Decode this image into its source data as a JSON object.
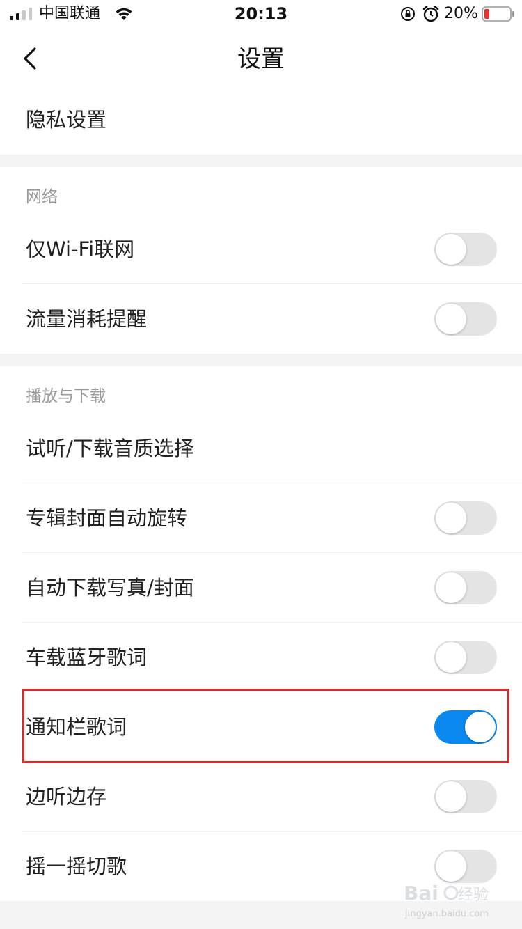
{
  "status_bar": {
    "carrier": "中国联通",
    "time": "20:13",
    "battery_percent": "20%",
    "battery_level": 0.2,
    "battery_color": "#e8312f"
  },
  "nav": {
    "title": "设置",
    "back_icon": "chevron-left-icon"
  },
  "top_rows": [
    {
      "label": "隐私设置"
    }
  ],
  "sections": [
    {
      "header": "网络",
      "rows": [
        {
          "label": "仅Wi-Fi联网",
          "toggle": false
        },
        {
          "label": "流量消耗提醒",
          "toggle": false
        }
      ]
    },
    {
      "header": "播放与下载",
      "rows": [
        {
          "label": "试听/下载音质选择"
        },
        {
          "label": "专辑封面自动旋转",
          "toggle": false
        },
        {
          "label": "自动下载写真/封面",
          "toggle": false
        },
        {
          "label": "车载蓝牙歌词",
          "toggle": false
        },
        {
          "label": "通知栏歌词",
          "toggle": true,
          "highlighted": true
        },
        {
          "label": "边听边存",
          "toggle": false
        },
        {
          "label": "摇一摇切歌",
          "toggle": false
        }
      ]
    }
  ],
  "colors": {
    "toggle_on": "#0a88f0",
    "toggle_off": "#e4e4e4",
    "highlight": "#d92a2a",
    "section_gap": "#f4f4f4"
  },
  "watermark": {
    "brand": "Bai du 经验",
    "url": "jingyan.baidu.com"
  }
}
